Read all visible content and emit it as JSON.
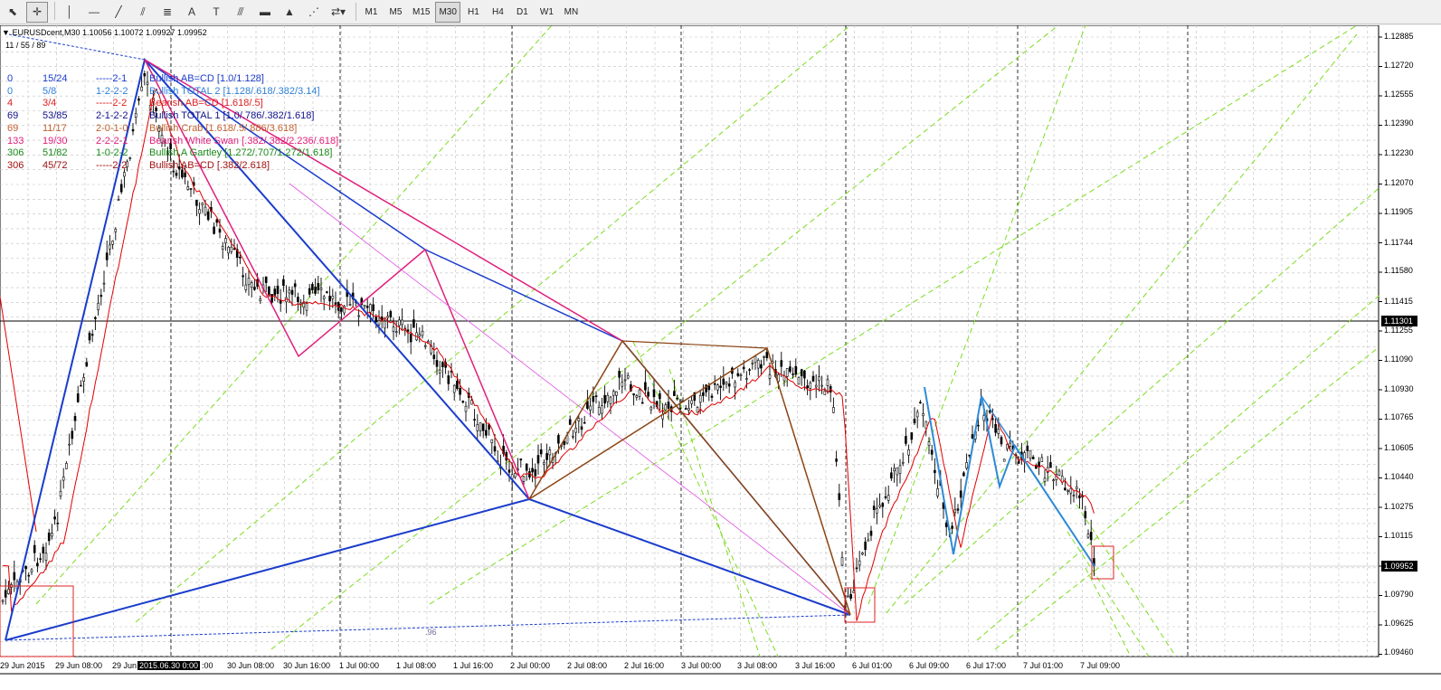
{
  "toolbar": {
    "tools": [
      {
        "name": "cursor-icon",
        "glyph": "⬉"
      },
      {
        "name": "crosshair-icon",
        "glyph": "✛"
      },
      {
        "name": "vertical-line-icon",
        "glyph": "│"
      },
      {
        "name": "horizontal-line-icon",
        "glyph": "—"
      },
      {
        "name": "trendline-icon",
        "glyph": "╱"
      },
      {
        "name": "equidistant-channel-icon",
        "glyph": "⫽"
      },
      {
        "name": "fibonacci-icon",
        "glyph": "≣"
      },
      {
        "name": "text-icon",
        "glyph": "A"
      },
      {
        "name": "text-label-icon",
        "glyph": "T"
      },
      {
        "name": "fibo-fan-icon",
        "glyph": "⫻"
      },
      {
        "name": "rectangle-icon",
        "glyph": "▬"
      },
      {
        "name": "triangle-icon",
        "glyph": "▲"
      },
      {
        "name": "pitchfork-icon",
        "glyph": "⋰"
      },
      {
        "name": "arrows-dropdown-icon",
        "glyph": "⇄▾"
      }
    ],
    "timeframes": [
      "M1",
      "M5",
      "M15",
      "M30",
      "H1",
      "H4",
      "D1",
      "W1",
      "MN"
    ],
    "active_timeframe": "M30"
  },
  "chart": {
    "symbol_line": "EURUSDcent,M30  1.10056 1.10072 1.09927 1.09952",
    "ma_line": "11 / 55 / 89",
    "current_price": "1.09952",
    "crosshair_price": "1.11301",
    "crosshair_time": "2015.06.30 0:00",
    "ruler_label": ".96",
    "price_axis": [
      "1.12885",
      "1.12720",
      "1.12555",
      "1.12390",
      "1.12230",
      "1.12070",
      "1.11905",
      "1.11744",
      "1.11580",
      "1.11415",
      "1.11255",
      "1.11090",
      "1.10930",
      "1.10765",
      "1.10605",
      "1.10440",
      "1.10275",
      "1.10115",
      "1.09790",
      "1.09625",
      "1.09460"
    ],
    "time_axis": [
      "29 Jun 2015",
      "29 Jun 08:00",
      "29 Jun",
      "30 Jun 08:00",
      "30 Jun 16:00",
      "1 Jul 00:00",
      "1 Jul 08:00",
      "1 Jul 16:00",
      "2 Jul 00:00",
      "2 Jul 08:00",
      "2 Jul 16:00",
      "3 Jul 00:00",
      "3 Jul 08:00",
      "3 Jul 16:00",
      "6 Jul 01:00",
      "6 Jul 09:00",
      "6 Jul 17:00",
      "7 Jul 01:00",
      "7 Jul 09:00"
    ],
    "time_axis_tail": ":00",
    "colors": {
      "bg": "#ffffff",
      "grid": "#c0c0c0",
      "candles": "#000000",
      "ma": "#e00000",
      "fib_green": "#7cdc1e"
    }
  },
  "patterns": [
    {
      "bars": "0",
      "ratio": "15/24",
      "code": "-----2-1",
      "name": "Bullish AB=CD [1.0/1.128]",
      "color": "#1a3ccc"
    },
    {
      "bars": "0",
      "ratio": "5/8",
      "code": "1-2-2-2",
      "name": "Bullish TOTAL 2 [1.128/.618/.382/3.14]",
      "color": "#2e7fd6"
    },
    {
      "bars": "4",
      "ratio": "3/4",
      "code": "-----2-2",
      "name": "Bearish AB=CD [1.618/.5]",
      "color": "#e02020"
    },
    {
      "bars": "69",
      "ratio": "53/85",
      "code": "2-1-2-2",
      "name": "Bullish TOTAL 1 [1.0/.786/.382/1.618]",
      "color": "#10108c"
    },
    {
      "bars": "69",
      "ratio": "11/17",
      "code": "2-0-1-0",
      "name": "Bullish Crab [1.618/.5/.886/3.618]",
      "color": "#c06030"
    },
    {
      "bars": "133",
      "ratio": "19/30",
      "code": "2-2-2-1",
      "name": "Bearish White Swan [.382/.382/2.236/.618]",
      "color": "#e0207c"
    },
    {
      "bars": "306",
      "ratio": "51/82",
      "code": "1-0-2-2",
      "name": "Bullish A Gartley [1.272/.707/1.272/1.618]",
      "color": "#1a8a1a"
    },
    {
      "bars": "306",
      "ratio": "45/72",
      "code": "-----2-2",
      "name": "Bullish AB=CD [.382/2.618]",
      "color": "#a01010"
    }
  ]
}
